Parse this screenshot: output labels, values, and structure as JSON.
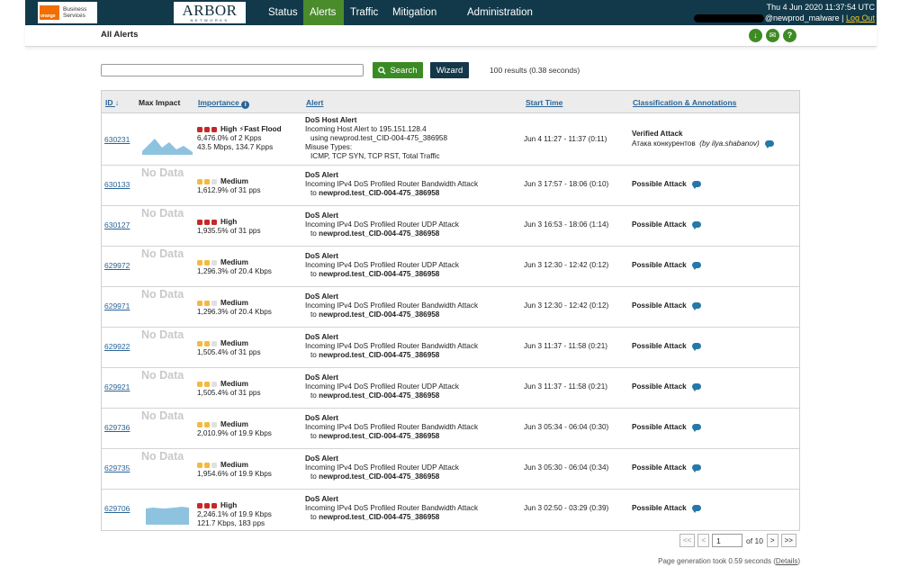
{
  "header": {
    "brand_business": "Business",
    "brand_services": "Services",
    "brand_orange": "orange",
    "arbor_logo": "ARBOR",
    "arbor_sub": "NETWORKS",
    "nav": [
      {
        "label": "Status",
        "active": false
      },
      {
        "label": "Alerts",
        "active": true
      },
      {
        "label": "Traffic",
        "active": false
      },
      {
        "label": "Mitigation",
        "active": false
      },
      {
        "label": "Administration",
        "active": false
      }
    ],
    "datetime": "Thu 4 Jun 2020 11:37:54 UTC",
    "username": "@newprod_malware",
    "separator": "|",
    "logout": "Log Out"
  },
  "page": {
    "title": "All Alerts",
    "icons": [
      "download-icon",
      "email-icon",
      "help-icon"
    ]
  },
  "search": {
    "value": "",
    "search_label": "Search",
    "wizard_label": "Wizard",
    "results": "100 results (0.38 seconds)"
  },
  "columns": {
    "id": "ID",
    "impact": "Max Impact",
    "importance": "Importance",
    "alert": "Alert",
    "start_time": "Start Time",
    "classification": "Classification & Annotations"
  },
  "rows": [
    {
      "id": "630231",
      "impact": "chart",
      "level": "High",
      "level_color": "high",
      "extra": "Fast Flood",
      "line1": "6,476.0% of 2 Kpps",
      "line2": "43.5 Mbps, 134.7 Kpps",
      "alert_title": "DoS Host Alert",
      "alert_l1": "Incoming Host Alert to 195.151.128.4",
      "alert_l2": "using newprod.test_CID-004-475_386958",
      "alert_l3": "Misuse Types:",
      "alert_l4": "ICMP, TCP SYN, TCP RST, Total Traffic",
      "time": "Jun 4 11:27 - 11:37 (0:11)",
      "class": "Verified Attack",
      "annotation": "Атака конкурентов",
      "annot_by": "(by ilya.shabanov)"
    },
    {
      "id": "630133",
      "impact": "nodata",
      "level": "Medium",
      "level_color": "medium",
      "line1": "1,612.9% of 31 pps",
      "line2": "",
      "alert_title": "DoS Alert",
      "alert_l1": "Incoming IPv4 DoS Profiled Router Bandwidth Attack",
      "alert_l2": "newprod.test_CID-004-475_386958",
      "time": "Jun 3 17:57 - 18:06 (0:10)",
      "class": "Possible Attack"
    },
    {
      "id": "630127",
      "impact": "nodata",
      "level": "High",
      "level_color": "high",
      "line1": "1,935.5% of 31 pps",
      "line2": "",
      "alert_title": "DoS Alert",
      "alert_l1": "Incoming IPv4 DoS Profiled Router UDP Attack",
      "alert_l2": "newprod.test_CID-004-475_386958",
      "time": "Jun 3 16:53 - 18:06 (1:14)",
      "class": "Possible Attack"
    },
    {
      "id": "629972",
      "impact": "nodata",
      "level": "Medium",
      "level_color": "medium",
      "line1": "1,296.3% of 20.4 Kbps",
      "line2": "",
      "alert_title": "DoS Alert",
      "alert_l1": "Incoming IPv4 DoS Profiled Router UDP Attack",
      "alert_l2": "newprod.test_CID-004-475_386958",
      "time": "Jun 3 12:30 - 12:42 (0:12)",
      "class": "Possible Attack"
    },
    {
      "id": "629971",
      "impact": "nodata",
      "level": "Medium",
      "level_color": "medium",
      "line1": "1,296.3% of 20.4 Kbps",
      "line2": "",
      "alert_title": "DoS Alert",
      "alert_l1": "Incoming IPv4 DoS Profiled Router Bandwidth Attack",
      "alert_l2": "newprod.test_CID-004-475_386958",
      "time": "Jun 3 12:30 - 12:42 (0:12)",
      "class": "Possible Attack"
    },
    {
      "id": "629922",
      "impact": "nodata",
      "level": "Medium",
      "level_color": "medium",
      "line1": "1,505.4% of 31 pps",
      "line2": "",
      "alert_title": "DoS Alert",
      "alert_l1": "Incoming IPv4 DoS Profiled Router Bandwidth Attack",
      "alert_l2": "newprod.test_CID-004-475_386958",
      "time": "Jun 3 11:37 - 11:58 (0:21)",
      "class": "Possible Attack"
    },
    {
      "id": "629921",
      "impact": "nodata",
      "level": "Medium",
      "level_color": "medium",
      "line1": "1,505.4% of 31 pps",
      "line2": "",
      "alert_title": "DoS Alert",
      "alert_l1": "Incoming IPv4 DoS Profiled Router UDP Attack",
      "alert_l2": "newprod.test_CID-004-475_386958",
      "time": "Jun 3 11:37 - 11:58 (0:21)",
      "class": "Possible Attack"
    },
    {
      "id": "629736",
      "impact": "nodata",
      "level": "Medium",
      "level_color": "medium",
      "line1": "2,010.9% of 19.9 Kbps",
      "line2": "",
      "alert_title": "DoS Alert",
      "alert_l1": "Incoming IPv4 DoS Profiled Router Bandwidth Attack",
      "alert_l2": "newprod.test_CID-004-475_386958",
      "time": "Jun 3 05:34 - 06:04 (0:30)",
      "class": "Possible Attack"
    },
    {
      "id": "629735",
      "impact": "nodata",
      "level": "Medium",
      "level_color": "medium",
      "line1": "1,954.6% of 19.9 Kbps",
      "line2": "",
      "alert_title": "DoS Alert",
      "alert_l1": "Incoming IPv4 DoS Profiled Router UDP Attack",
      "alert_l2": "newprod.test_CID-004-475_386958",
      "time": "Jun 3 05:30 - 06:04 (0:34)",
      "class": "Possible Attack"
    },
    {
      "id": "629706",
      "impact": "chart",
      "level": "High",
      "level_color": "high",
      "line1": "2,246.1% of 19.9 Kbps",
      "line2": "121.7 Kbps, 183 pps",
      "alert_title": "DoS Alert",
      "alert_l1": "Incoming IPv4 DoS Profiled Router Bandwidth Attack",
      "alert_l2": "newprod.test_CID-004-475_386958",
      "time": "Jun 3 02:50 - 03:29 (0:39)",
      "class": "Possible Attack"
    }
  ],
  "no_data_label": "No Data",
  "colors": {
    "high": "#c62828",
    "medium": "#f4b942",
    "empty": "#e0e0e0",
    "chart": "#8ec3e0",
    "accent": "#3a8b24",
    "nav": "#11394a"
  },
  "pagination": {
    "first": "<<",
    "prev": "<",
    "page": "1",
    "of": "of 10",
    "next": ">",
    "last": ">>"
  },
  "footer": {
    "generation": "Page generation took 0.59 seconds (",
    "details": "Details",
    "close": ")"
  }
}
